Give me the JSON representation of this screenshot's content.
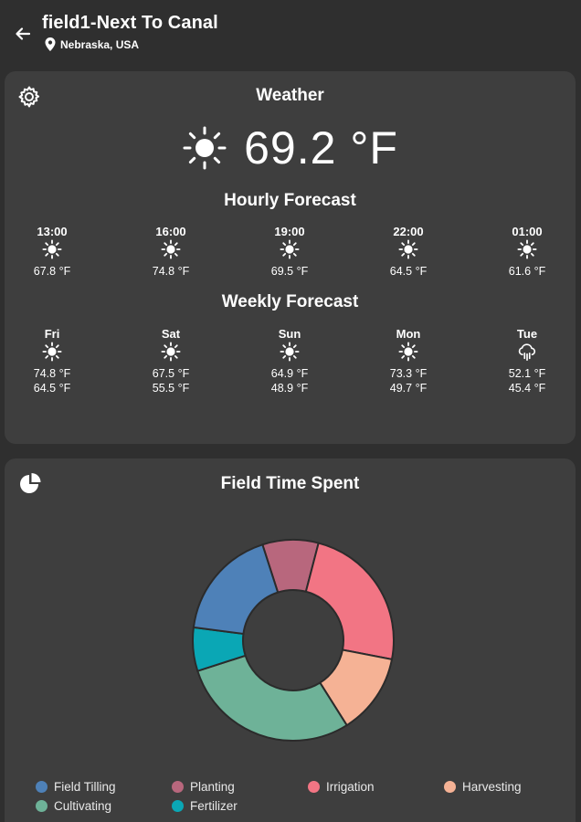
{
  "header": {
    "title": "field1-Next To Canal",
    "location": "Nebraska, USA"
  },
  "weather": {
    "title": "Weather",
    "current_temp": "69.2 °F",
    "hourly_title": "Hourly Forecast",
    "hourly": [
      {
        "time": "13:00",
        "icon": "sun-icon",
        "temp": "67.8 °F"
      },
      {
        "time": "16:00",
        "icon": "sun-icon",
        "temp": "74.8 °F"
      },
      {
        "time": "19:00",
        "icon": "sun-icon",
        "temp": "69.5 °F"
      },
      {
        "time": "22:00",
        "icon": "sun-icon",
        "temp": "64.5 °F"
      },
      {
        "time": "01:00",
        "icon": "sun-icon",
        "temp": "61.6 °F"
      }
    ],
    "weekly_title": "Weekly Forecast",
    "weekly": [
      {
        "day": "Fri",
        "icon": "sun-icon",
        "high": "74.8 °F",
        "low": "64.5 °F"
      },
      {
        "day": "Sat",
        "icon": "sun-icon",
        "high": "67.5 °F",
        "low": "55.5 °F"
      },
      {
        "day": "Sun",
        "icon": "sun-icon",
        "high": "64.9 °F",
        "low": "48.9 °F"
      },
      {
        "day": "Mon",
        "icon": "sun-icon",
        "high": "73.3 °F",
        "low": "49.7 °F"
      },
      {
        "day": "Tue",
        "icon": "rain-cloud-icon",
        "high": "52.1 °F",
        "low": "45.4 °F"
      }
    ]
  },
  "time_spent": {
    "title": "Field Time Spent",
    "legend": [
      {
        "label": "Field Tilling",
        "color": "#4e81b8"
      },
      {
        "label": "Planting",
        "color": "#b8677d"
      },
      {
        "label": "Irrigation",
        "color": "#f27584"
      },
      {
        "label": "Harvesting",
        "color": "#f5b295"
      },
      {
        "label": "Cultivating",
        "color": "#6eb298"
      },
      {
        "label": "Fertilizer",
        "color": "#0aa7b5"
      }
    ]
  },
  "chart_data": {
    "type": "pie",
    "title": "Field Time Spent",
    "categories": [
      "Field Tilling",
      "Planting",
      "Irrigation",
      "Harvesting",
      "Cultivating",
      "Fertilizer"
    ],
    "values": [
      18,
      9,
      24,
      13,
      29,
      7
    ],
    "colors": [
      "#4e81b8",
      "#b8677d",
      "#f27584",
      "#f5b295",
      "#6eb298",
      "#0aa7b5"
    ]
  }
}
